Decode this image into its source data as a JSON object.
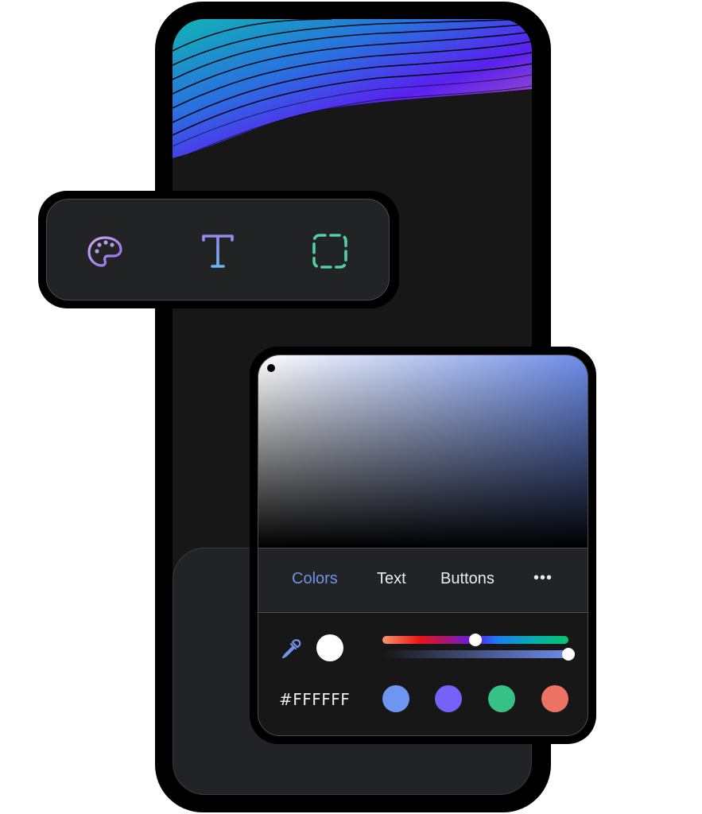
{
  "toolbar": {
    "tools": [
      {
        "name": "palette-icon",
        "label": "Colors",
        "color": "#a98bef"
      },
      {
        "name": "text-icon",
        "label": "Text",
        "color": "#7fa8f0"
      },
      {
        "name": "selection-icon",
        "label": "Selection",
        "color": "#4fd1a3"
      }
    ]
  },
  "picker": {
    "base_color": "#6d8ce8",
    "tabs": [
      {
        "label": "Colors",
        "active": true
      },
      {
        "label": "Text",
        "active": false
      },
      {
        "label": "Buttons",
        "active": false
      }
    ],
    "more_label": "•••",
    "current_color": "#FFFFFF",
    "hex_value": "#FFFFFF",
    "hue_position": 0.5,
    "alpha_position": 1.0,
    "presets": [
      "#6f95f2",
      "#7461f8",
      "#36c187",
      "#ec7263"
    ]
  }
}
